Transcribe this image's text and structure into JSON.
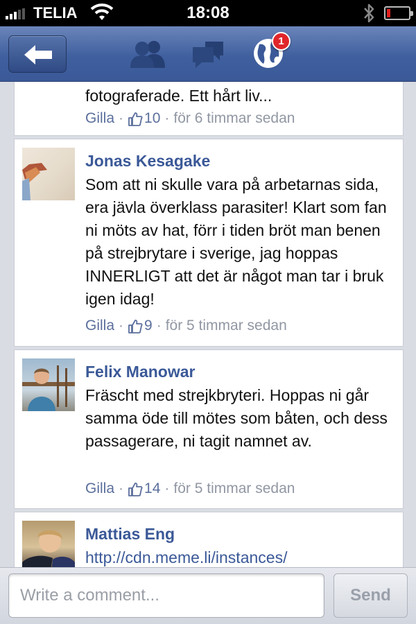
{
  "status_bar": {
    "carrier": "TELIA",
    "time": "18:08",
    "battery_level": 0.15,
    "signal_bars": 3,
    "battery_color": "#e01e1e"
  },
  "nav": {
    "back_icon": "back-arrow-icon",
    "friends_icon": "friend-requests-icon",
    "messages_icon": "messages-icon",
    "notifications_icon": "notifications-globe-icon",
    "notifications_badge": "1",
    "brand_color": "#3b5998"
  },
  "comments": [
    {
      "name": "",
      "text": "fotograferade. Ett hårt liv...",
      "like_label": "Gilla",
      "like_count": "10",
      "time": "för 6 timmar sedan"
    },
    {
      "name": "Jonas Kesagake",
      "text": "Som att ni skulle vara på arbetarnas sida, era jävla överklass parasiter! Klart som fan ni möts av hat, förr i tiden bröt man benen på strejbrytare i sverige, jag hoppas INNERLIGT att det är något man tar i bruk igen idag!",
      "like_label": "Gilla",
      "like_count": "9",
      "time": "för 5 timmar sedan"
    },
    {
      "name": "Felix Manowar",
      "text": "Fräscht med strejkbryteri. Hoppas ni går samma öde till mötes som båten, och dess passagerare, ni tagit namnet av.",
      "like_label": "Gilla",
      "like_count": "14",
      "time": "för 5 timmar sedan"
    },
    {
      "name": "Mattias Eng",
      "text": "http://cdn.meme.li/instances/"
    }
  ],
  "composer": {
    "placeholder": "Write a comment...",
    "value": "",
    "send_label": "Send"
  }
}
